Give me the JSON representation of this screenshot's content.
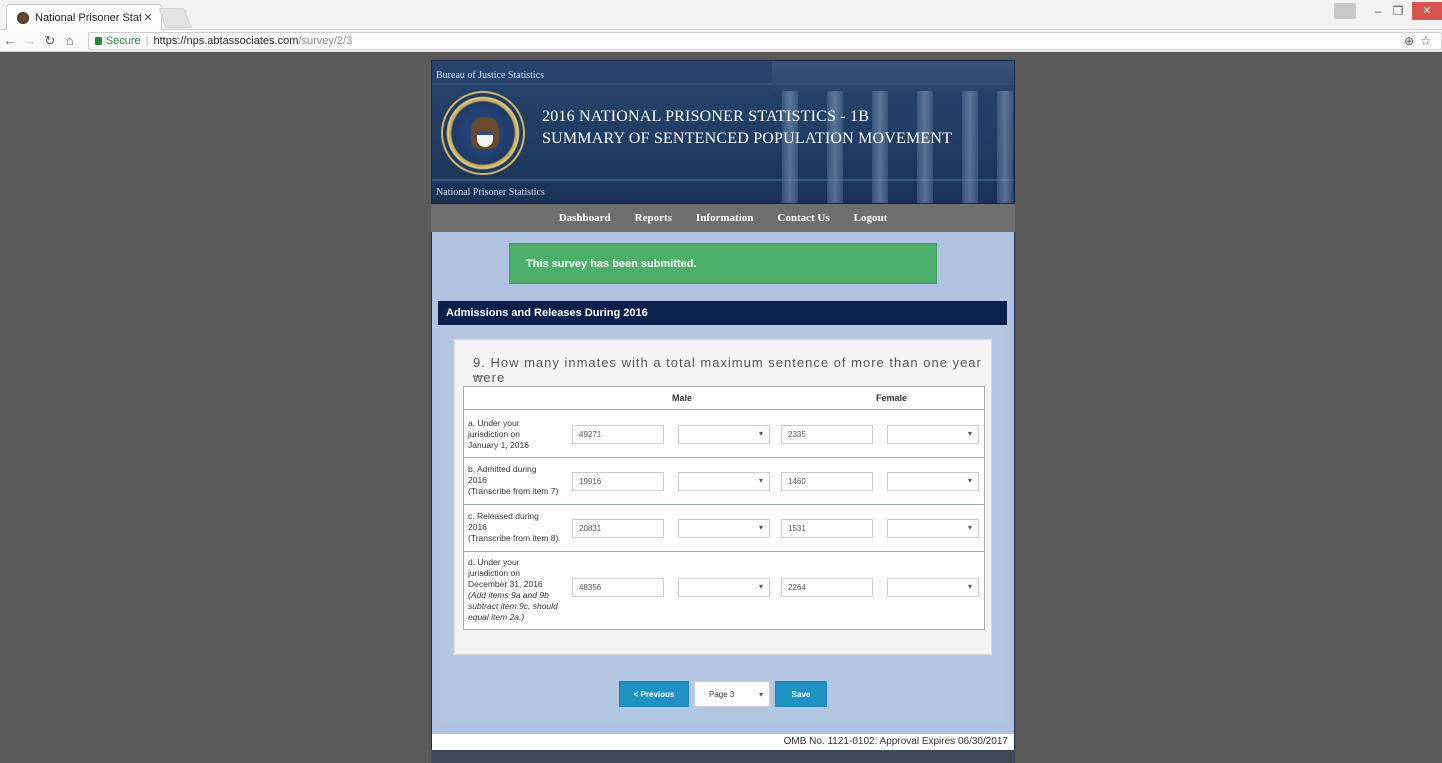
{
  "browser": {
    "tab_title": "National Prisoner Statist",
    "secure_label": "Secure",
    "url_host": "https://nps.abtassociates.com",
    "url_path": "/survey/2/3"
  },
  "header": {
    "agency_top": "Bureau of Justice Statistics",
    "agency_bottom": "National Prisoner Statistics",
    "title_line1": "2016 NATIONAL PRISONER STATISTICS - 1B",
    "title_line2": "SUMMARY OF SENTENCED POPULATION MOVEMENT"
  },
  "nav": {
    "items": [
      "Dashboard",
      "Reports",
      "Information",
      "Contact Us",
      "Logout"
    ]
  },
  "alert": {
    "message": "This survey has been submitted."
  },
  "section": {
    "title": "Admissions and Releases During 2016"
  },
  "question": {
    "text": "9. How many inmates with a total maximum sentence of more than one year were",
    "trail": "—"
  },
  "table": {
    "headers": {
      "male": "Male",
      "female": "Female"
    },
    "rows": [
      {
        "label_lines": [
          "a. Under your",
          "jurisdiction on",
          "January 1, 2016"
        ],
        "male": "49271",
        "female": "2335"
      },
      {
        "label_lines": [
          "b. Admitted during",
          "2016",
          "(Transcribe from item 7)"
        ],
        "male": "19916",
        "female": "1460"
      },
      {
        "label_lines": [
          "c. Released during",
          "2016",
          "(Transcribe from item 8)"
        ],
        "male": "20831",
        "female": "1531"
      },
      {
        "label_lines": [
          "d. Under your",
          "jurisdiction on",
          "December 31, 2016"
        ],
        "note_lines": [
          "(Add items 9a and 9b",
          "subtract item 9c, should",
          "equal item 2a.)"
        ],
        "male": "48356",
        "female": "2264"
      }
    ]
  },
  "pager": {
    "prev_label": "< Previous",
    "page_label": "Page 3",
    "save_label": "Save"
  },
  "footer": {
    "omb": "OMB No. 1121-0102: Approval Expires 06/30/2017"
  }
}
